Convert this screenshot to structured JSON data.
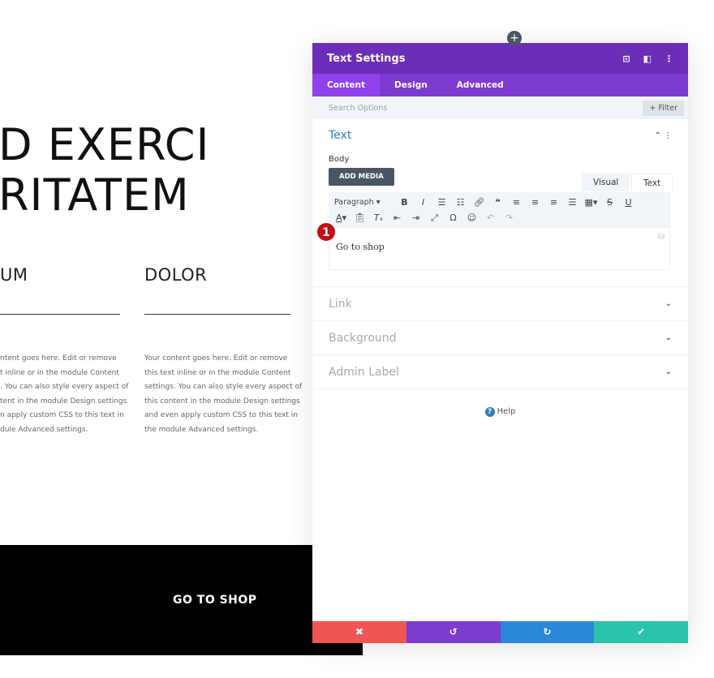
{
  "page": {
    "hero_lines": [
      "D EXERCI",
      "RITATEM"
    ],
    "col1": {
      "heading": "UM",
      "lines": [
        "ntent goes here. Edit or remove",
        "t inline or in the module Content",
        ". You can also style every aspect of",
        "tent in the module Design settings",
        "n apply custom CSS to this text in",
        "dule Advanced settings."
      ]
    },
    "col2": {
      "heading": "DOLOR",
      "lines": [
        "Your content goes here. Edit or remove",
        "this text inline or in the module Content",
        "settings. You can also style every aspect of",
        "this content in the module Design settings",
        "and even apply custom CSS to this text in",
        "the module Advanced settings."
      ]
    },
    "cta": "GO TO SHOP"
  },
  "panel": {
    "title": "Text Settings",
    "tabs": [
      "Content",
      "Design",
      "Advanced"
    ],
    "search_placeholder": "Search Options",
    "filter": "+ Filter",
    "text_section": "Text",
    "body_label": "Body",
    "add_media": "ADD MEDIA",
    "modes": [
      "Visual",
      "Text"
    ],
    "format": "Paragraph",
    "content": "Go to shop",
    "badge": "1",
    "sections": [
      "Link",
      "Background",
      "Admin Label"
    ],
    "help": "Help",
    "colors": {
      "header": "#6c2eb9",
      "tabs": "#7e3bd0",
      "cancel": "#ef5555",
      "undo": "#7e3bd0",
      "redo": "#2b87da",
      "save": "#29c4a9"
    }
  }
}
